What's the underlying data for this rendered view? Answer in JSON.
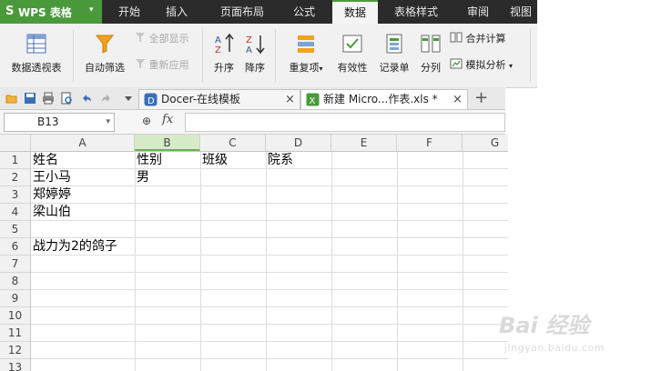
{
  "app": {
    "logo_glyph": "S",
    "name": "WPS 表格",
    "dropdown": "▾"
  },
  "menu_tabs": [
    "开始",
    "插入",
    "页面布局",
    "公式",
    "数据",
    "表格样式",
    "审阅",
    "视图"
  ],
  "active_menu_tab": "数据",
  "ribbon": {
    "pivot_table": "数据透视表",
    "auto_filter": "自动筛选",
    "show_all": "全部显示",
    "reapply": "重新应用",
    "sort_asc": "升序",
    "sort_desc": "降序",
    "duplicates": "重复项",
    "duplicates_arrow": "▾",
    "validity": "有效性",
    "record_sheet": "记录单",
    "split": "分列",
    "merge_calc": "合并计算",
    "simulation": "模拟分析",
    "simulation_arrow": "▾"
  },
  "doc_tabs": [
    {
      "label": "Docer-在线模板",
      "close": "×"
    },
    {
      "label": "新建 Micro...作表.xls *",
      "close": "×"
    }
  ],
  "new_tab": "+",
  "formula_bar": {
    "cell_ref": "B13",
    "dropdown": "▾",
    "zoom_icon": "⊕",
    "fx": "fx",
    "content": ""
  },
  "columns": [
    "A",
    "B",
    "C",
    "D",
    "E",
    "F",
    "G"
  ],
  "selected_column": "B",
  "rows": [
    "1",
    "2",
    "3",
    "4",
    "5",
    "6",
    "7",
    "8",
    "9",
    "10",
    "11",
    "12",
    "13"
  ],
  "cells": {
    "A1": "姓名",
    "B1": "性别",
    "C1": "班级",
    "D1": "院系",
    "A2": "王小马",
    "B2": "男",
    "A3": "郑婷婷",
    "A4": "梁山伯",
    "A6": "战力为2的鸽子"
  },
  "watermark": {
    "brand": "Bai 经验",
    "url": "jingyan.baidu.com"
  },
  "colors": {
    "accent": "#4a9a3c",
    "menubar": "#2b2b2b",
    "selected_header": "#d6ebc8"
  }
}
